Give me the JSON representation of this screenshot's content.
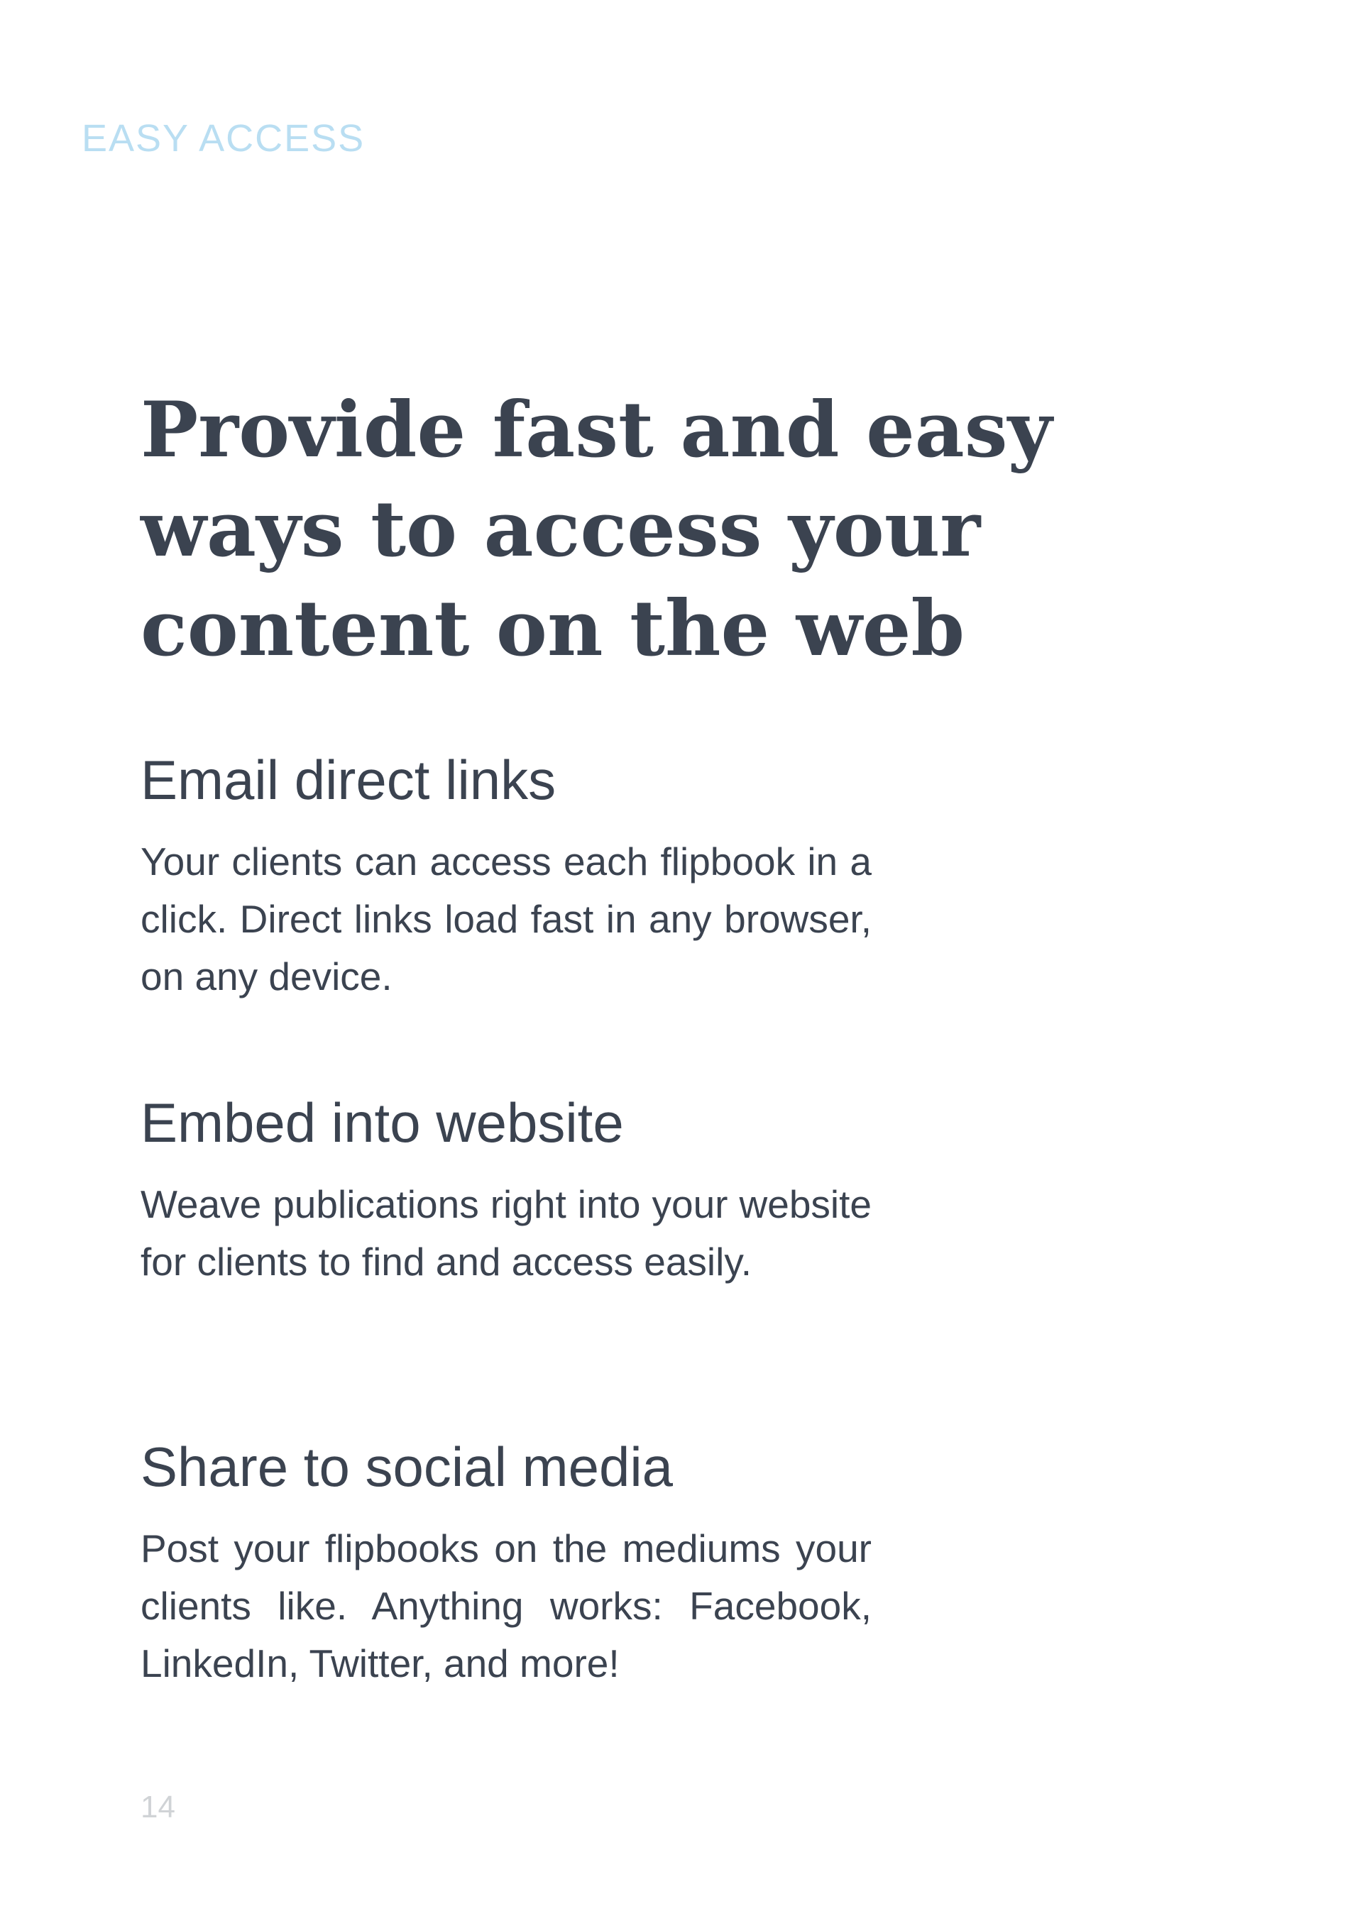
{
  "section_label": "EASY ACCESS",
  "title": "Provide fast and easy ways to access your content on the web",
  "features": [
    {
      "heading": "Email direct links",
      "body": "Your clients can access each flipbook in a click. Direct links load fast in any browser, on any device."
    },
    {
      "heading": "Embed into website",
      "body": "Weave publications right into your website for clients to find and access easily."
    },
    {
      "heading": "Share to social media",
      "body": "Post your flipbooks on the mediums your clients like. Anything works: Facebook, LinkedIn, Twitter, and more!"
    }
  ],
  "page_number": "14",
  "colors": {
    "label": "#b9def2",
    "text": "#3b4350",
    "page_number": "#d0d3d6"
  }
}
